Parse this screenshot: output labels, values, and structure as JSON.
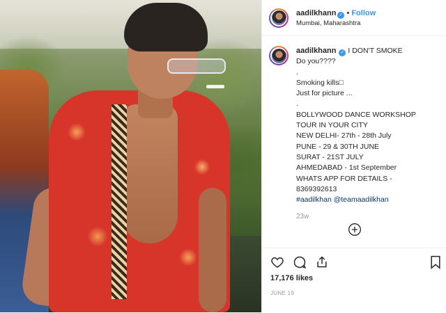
{
  "header": {
    "username": "aadilkhann",
    "follow_label": "Follow",
    "location": "Mumbai, Maharashtra"
  },
  "caption": {
    "username": "aadilkhann",
    "lines": [
      "I DON'T SMOKE",
      "Do you????",
      ".",
      "Smoking kills□",
      "Just for picture ...",
      ".",
      "BOLLYWOOD DANCE WORKSHOP",
      "TOUR IN YOUR CITY",
      "NEW DELHI- 27th - 28th July",
      "PUNE - 29 & 30TH JUNE",
      "SURAT - 21ST JULY",
      "AHMEDABAD - 1st September",
      "WHATS APP FOR DETAILS -",
      "8369392613"
    ],
    "hashtags": [
      "#aadilkhan",
      "@teamaadilkhan"
    ],
    "time_ago": "23w"
  },
  "actions": {
    "likes": "17,176 likes",
    "date": "JUNE 19"
  },
  "icons": {
    "verified": "verified-badge-icon",
    "load_more": "plus-circle-icon",
    "like": "heart-icon",
    "comment": "comment-icon",
    "share": "share-icon",
    "save": "bookmark-icon"
  },
  "colors": {
    "accent": "#3897f0",
    "text": "#262626",
    "muted": "#999999",
    "hashtag": "#003569"
  }
}
